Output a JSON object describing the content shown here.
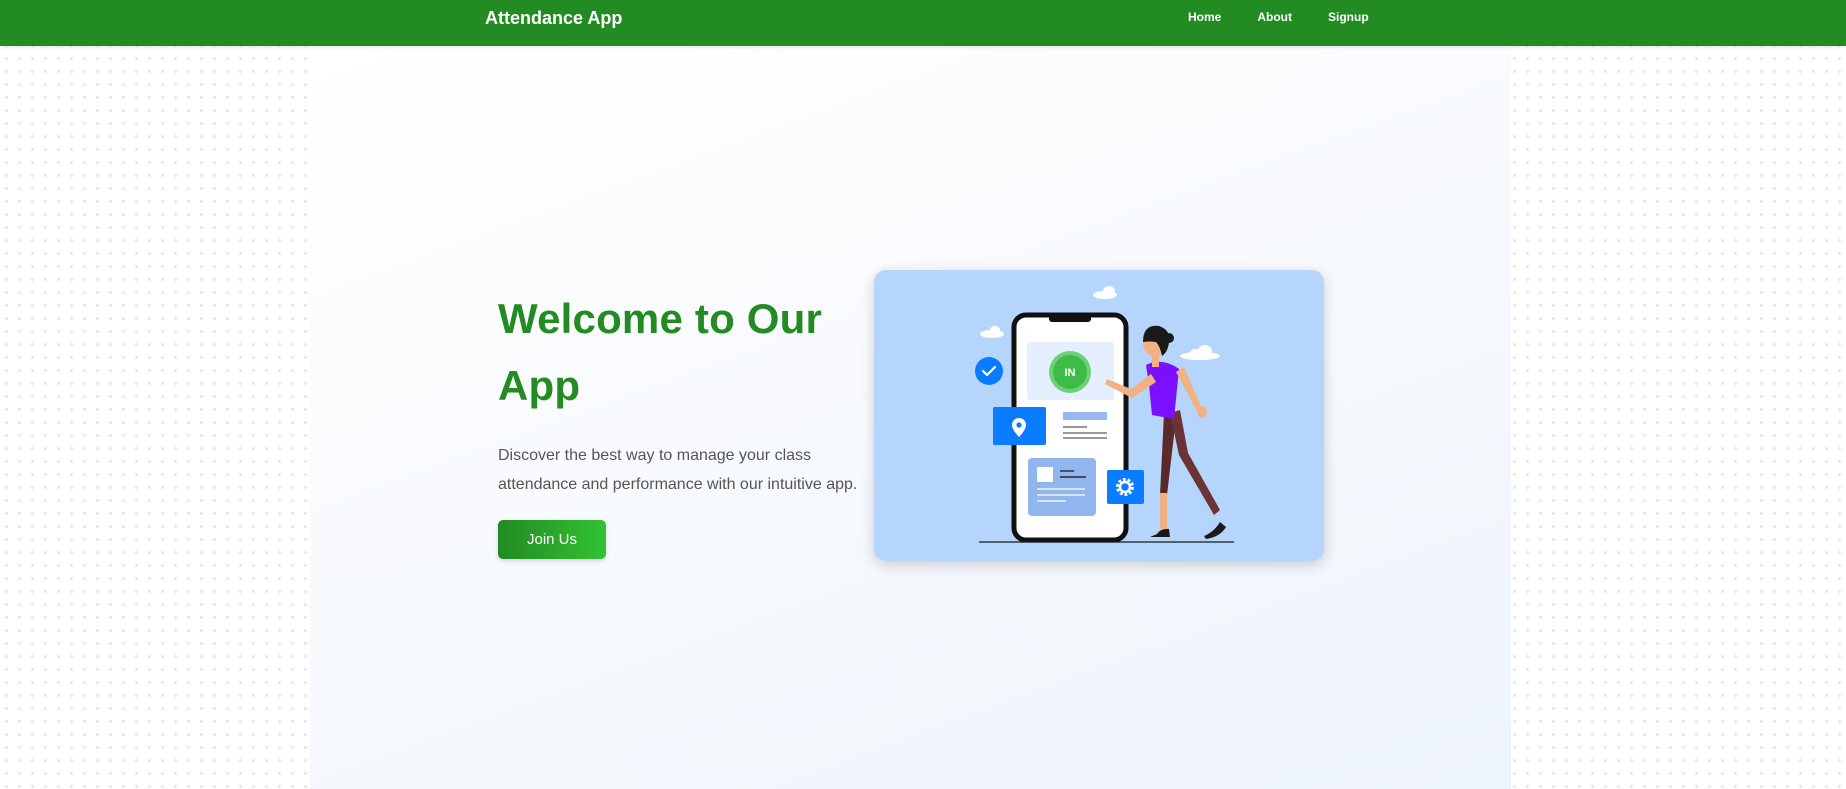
{
  "navbar": {
    "brand": "Attendance App",
    "links": [
      "Home",
      "About",
      "Signup"
    ],
    "color": "#228b22"
  },
  "hero": {
    "title": "Welcome to Our App",
    "description": "Discover the best way to manage your class attendance and performance with our intuitive app.",
    "cta_label": "Join Us"
  },
  "illustration": {
    "check_in_label": "IN",
    "icons": [
      "check-icon",
      "location-pin-icon",
      "gear-icon"
    ]
  },
  "colors": {
    "accent_green": "#228b22",
    "card_background": "#b5d5fd",
    "icon_blue": "#0a7cff",
    "shirt_purple": "#7b0fff"
  }
}
